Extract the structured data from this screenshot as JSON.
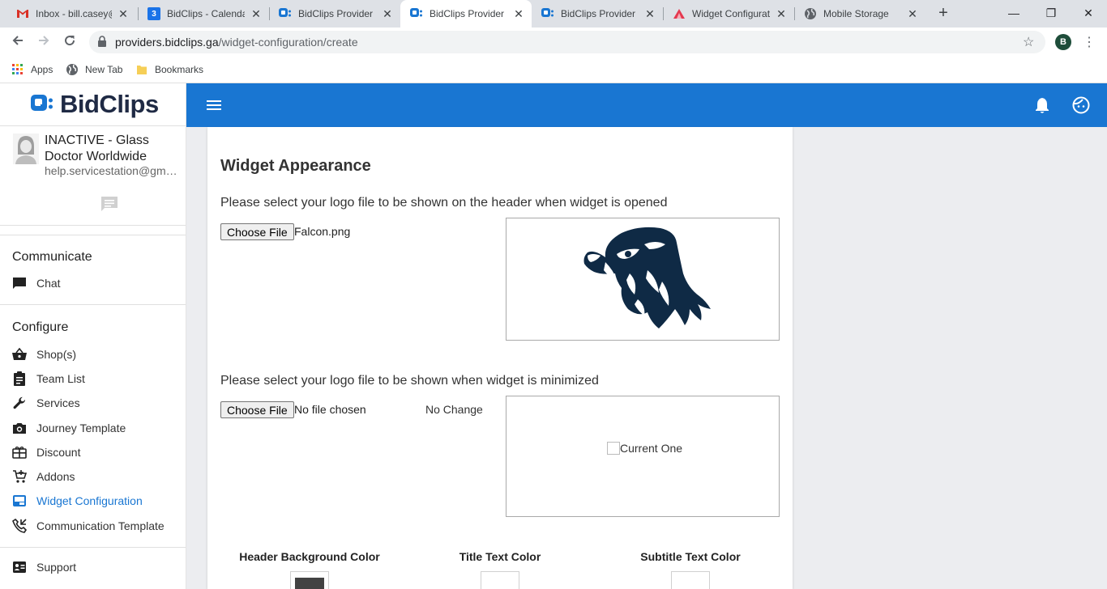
{
  "browser": {
    "tabs": [
      {
        "label": "Inbox - bill.casey@",
        "favicon": "gmail-icon",
        "active": false
      },
      {
        "label": "BidClips - Calenda",
        "favicon": "calendar-icon",
        "active": false
      },
      {
        "label": "BidClips Provider P",
        "favicon": "bidclips-icon",
        "active": false
      },
      {
        "label": "BidClips Provider P",
        "favicon": "bidclips-icon",
        "active": true
      },
      {
        "label": "BidClips Provider P",
        "favicon": "bidclips-icon",
        "active": false
      },
      {
        "label": "Widget Configurati",
        "favicon": "widget-icon",
        "active": false
      },
      {
        "label": "Mobile Storage",
        "favicon": "globe-icon",
        "active": false
      }
    ],
    "calendar_day": "3",
    "url_host": "providers.bidclips.ga",
    "url_path": "/widget-configuration/create",
    "profile_initial": "B",
    "bookmarks": [
      {
        "label": "Apps",
        "icon": "apps-grid-icon"
      },
      {
        "label": "New Tab",
        "icon": "globe-icon"
      },
      {
        "label": "Bookmarks",
        "icon": "folder-icon"
      }
    ]
  },
  "app": {
    "brand": "BidClips",
    "account": {
      "name": "INACTIVE - Glass Doctor Worldwide",
      "email": "help.servicestation@gmail.com"
    },
    "sections": {
      "communicate": "Communicate",
      "configure": "Configure"
    },
    "nav": {
      "chat": "Chat",
      "shops": "Shop(s)",
      "team_list": "Team List",
      "services": "Services",
      "journey_template": "Journey Template",
      "discount": "Discount",
      "addons": "Addons",
      "widget_configuration": "Widget Configuration",
      "communication_template": "Communication Template",
      "support": "Support"
    },
    "active_nav": "widget_configuration",
    "accent_color": "#1976d2"
  },
  "widget": {
    "title": "Widget Appearance",
    "header_logo": {
      "prompt": "Please select your logo file to be shown on the header when widget is opened",
      "button": "Choose File",
      "file": "Falcon.png"
    },
    "min_logo": {
      "prompt": "Please select your logo file to be shown when widget is minimized",
      "button": "Choose File",
      "file": "No file chosen",
      "status": "No Change",
      "preview_alt": "Current One"
    },
    "colors": [
      {
        "label": "Header Background Color",
        "value": "#424242"
      },
      {
        "label": "Title Text Color",
        "value": "#ffffff"
      },
      {
        "label": "Subtitle Text Color",
        "value": "#ffffff"
      }
    ]
  }
}
